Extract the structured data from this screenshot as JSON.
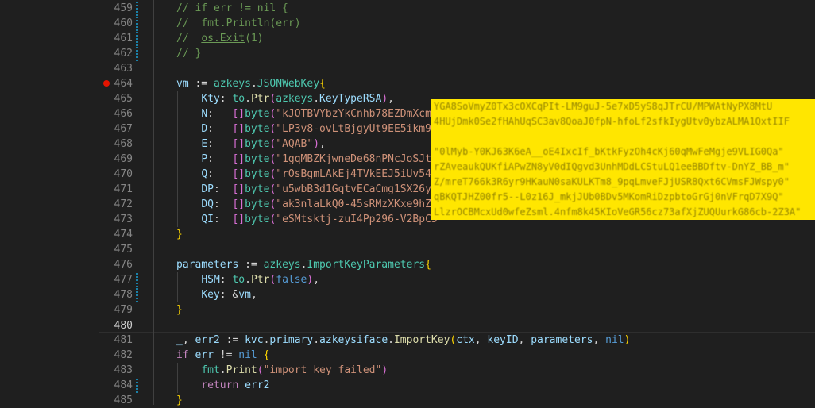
{
  "editor": {
    "lines": [
      {
        "num": "459",
        "tokens": [
          {
            "t": "// if err != nil {",
            "c": "c-comment"
          }
        ]
      },
      {
        "num": "460",
        "tokens": [
          {
            "t": "//  fmt.Println(err)",
            "c": "c-comment"
          }
        ]
      },
      {
        "num": "461",
        "tokens": [
          {
            "t": "//  ",
            "c": "c-comment"
          },
          {
            "t": "os.Exit",
            "c": "c-comment c-under"
          },
          {
            "t": "(1)",
            "c": "c-comment"
          }
        ]
      },
      {
        "num": "462",
        "tokens": [
          {
            "t": "// }",
            "c": "c-comment"
          }
        ]
      },
      {
        "num": "463",
        "tokens": []
      },
      {
        "num": "464",
        "breakpoint": true,
        "tokens": [
          {
            "t": "vm",
            "c": "c-var"
          },
          {
            "t": " := ",
            "c": "c-plain"
          },
          {
            "t": "azkeys",
            "c": "c-type"
          },
          {
            "t": ".",
            "c": "c-plain"
          },
          {
            "t": "JSONWebKey",
            "c": "c-type"
          },
          {
            "t": "{",
            "c": "c-b1"
          }
        ]
      },
      {
        "num": "465",
        "tokens": [
          {
            "t": "    ",
            "c": "c-plain"
          },
          {
            "t": "Kty",
            "c": "c-var"
          },
          {
            "t": ": ",
            "c": "c-plain"
          },
          {
            "t": "to",
            "c": "c-type"
          },
          {
            "t": ".",
            "c": "c-plain"
          },
          {
            "t": "Ptr",
            "c": "c-func"
          },
          {
            "t": "(",
            "c": "c-b2"
          },
          {
            "t": "azkeys",
            "c": "c-type"
          },
          {
            "t": ".",
            "c": "c-plain"
          },
          {
            "t": "KeyTypeRSA",
            "c": "c-var"
          },
          {
            "t": ")",
            "c": "c-b2"
          },
          {
            "t": ",",
            "c": "c-plain"
          }
        ]
      },
      {
        "num": "466",
        "tokens": [
          {
            "t": "    ",
            "c": "c-plain"
          },
          {
            "t": "N",
            "c": "c-var"
          },
          {
            "t": ":   ",
            "c": "c-plain"
          },
          {
            "t": "[]",
            "c": "c-b2"
          },
          {
            "t": "byte",
            "c": "c-type"
          },
          {
            "t": "(",
            "c": "c-b2"
          },
          {
            "t": "\"kJOTBVYbzYkCnhb78EZDmXcmH",
            "c": "c-str"
          }
        ]
      },
      {
        "num": "467",
        "tokens": [
          {
            "t": "    ",
            "c": "c-plain"
          },
          {
            "t": "D",
            "c": "c-var"
          },
          {
            "t": ":   ",
            "c": "c-plain"
          },
          {
            "t": "[]",
            "c": "c-b2"
          },
          {
            "t": "byte",
            "c": "c-type"
          },
          {
            "t": "(",
            "c": "c-b2"
          },
          {
            "t": "\"LP3v8-ovLtBjgyUt9EE5ikm9E",
            "c": "c-str"
          }
        ]
      },
      {
        "num": "468",
        "tokens": [
          {
            "t": "    ",
            "c": "c-plain"
          },
          {
            "t": "E",
            "c": "c-var"
          },
          {
            "t": ":   ",
            "c": "c-plain"
          },
          {
            "t": "[]",
            "c": "c-b2"
          },
          {
            "t": "byte",
            "c": "c-type"
          },
          {
            "t": "(",
            "c": "c-b2"
          },
          {
            "t": "\"AQAB\"",
            "c": "c-str"
          },
          {
            "t": ")",
            "c": "c-b2"
          },
          {
            "t": ",",
            "c": "c-plain"
          }
        ]
      },
      {
        "num": "469",
        "tokens": [
          {
            "t": "    ",
            "c": "c-plain"
          },
          {
            "t": "P",
            "c": "c-var"
          },
          {
            "t": ":   ",
            "c": "c-plain"
          },
          {
            "t": "[]",
            "c": "c-b2"
          },
          {
            "t": "byte",
            "c": "c-type"
          },
          {
            "t": "(",
            "c": "c-b2"
          },
          {
            "t": "\"1gqMBZKjwneDe68nPNcJoSJt4",
            "c": "c-str"
          }
        ]
      },
      {
        "num": "470",
        "tokens": [
          {
            "t": "    ",
            "c": "c-plain"
          },
          {
            "t": "Q",
            "c": "c-var"
          },
          {
            "t": ":   ",
            "c": "c-plain"
          },
          {
            "t": "[]",
            "c": "c-b2"
          },
          {
            "t": "byte",
            "c": "c-type"
          },
          {
            "t": "(",
            "c": "c-b2"
          },
          {
            "t": "\"rOsBgmLAkEj4TVkEEJ5iUv54f",
            "c": "c-str"
          }
        ]
      },
      {
        "num": "471",
        "tokens": [
          {
            "t": "    ",
            "c": "c-plain"
          },
          {
            "t": "DP",
            "c": "c-var"
          },
          {
            "t": ":  ",
            "c": "c-plain"
          },
          {
            "t": "[]",
            "c": "c-b2"
          },
          {
            "t": "byte",
            "c": "c-type"
          },
          {
            "t": "(",
            "c": "c-b2"
          },
          {
            "t": "\"u5wbB3d1GqtvECaCmg1SX26yK",
            "c": "c-str"
          }
        ]
      },
      {
        "num": "472",
        "tokens": [
          {
            "t": "    ",
            "c": "c-plain"
          },
          {
            "t": "DQ",
            "c": "c-var"
          },
          {
            "t": ":  ",
            "c": "c-plain"
          },
          {
            "t": "[]",
            "c": "c-b2"
          },
          {
            "t": "byte",
            "c": "c-type"
          },
          {
            "t": "(",
            "c": "c-b2"
          },
          {
            "t": "\"ak3nlaLkQ0-45sRMzXKxe9hZq",
            "c": "c-str"
          }
        ]
      },
      {
        "num": "473",
        "tokens": [
          {
            "t": "    ",
            "c": "c-plain"
          },
          {
            "t": "QI",
            "c": "c-var"
          },
          {
            "t": ":  ",
            "c": "c-plain"
          },
          {
            "t": "[]",
            "c": "c-b2"
          },
          {
            "t": "byte",
            "c": "c-type"
          },
          {
            "t": "(",
            "c": "c-b2"
          },
          {
            "t": "\"eSMtsktj-zuI4Pp296-V2BpC5",
            "c": "c-str"
          }
        ]
      },
      {
        "num": "474",
        "tokens": [
          {
            "t": "}",
            "c": "c-b1"
          }
        ]
      },
      {
        "num": "475",
        "tokens": []
      },
      {
        "num": "476",
        "tokens": [
          {
            "t": "parameters",
            "c": "c-var"
          },
          {
            "t": " := ",
            "c": "c-plain"
          },
          {
            "t": "azkeys",
            "c": "c-type"
          },
          {
            "t": ".",
            "c": "c-plain"
          },
          {
            "t": "ImportKeyParameters",
            "c": "c-type"
          },
          {
            "t": "{",
            "c": "c-b1"
          }
        ]
      },
      {
        "num": "477",
        "tokens": [
          {
            "t": "    ",
            "c": "c-plain"
          },
          {
            "t": "HSM",
            "c": "c-var"
          },
          {
            "t": ": ",
            "c": "c-plain"
          },
          {
            "t": "to",
            "c": "c-type"
          },
          {
            "t": ".",
            "c": "c-plain"
          },
          {
            "t": "Ptr",
            "c": "c-func"
          },
          {
            "t": "(",
            "c": "c-b2"
          },
          {
            "t": "false",
            "c": "c-kw"
          },
          {
            "t": ")",
            "c": "c-b2"
          },
          {
            "t": ",",
            "c": "c-plain"
          }
        ]
      },
      {
        "num": "478",
        "tokens": [
          {
            "t": "    ",
            "c": "c-plain"
          },
          {
            "t": "Key",
            "c": "c-var"
          },
          {
            "t": ": &",
            "c": "c-plain"
          },
          {
            "t": "vm",
            "c": "c-var"
          },
          {
            "t": ",",
            "c": "c-plain"
          }
        ]
      },
      {
        "num": "479",
        "tokens": [
          {
            "t": "}",
            "c": "c-b1"
          }
        ]
      },
      {
        "num": "480",
        "current": true,
        "tokens": []
      },
      {
        "num": "481",
        "tokens": [
          {
            "t": "_",
            "c": "c-var"
          },
          {
            "t": ", ",
            "c": "c-plain"
          },
          {
            "t": "err2",
            "c": "c-var"
          },
          {
            "t": " := ",
            "c": "c-plain"
          },
          {
            "t": "kvc",
            "c": "c-var"
          },
          {
            "t": ".",
            "c": "c-plain"
          },
          {
            "t": "primary",
            "c": "c-var"
          },
          {
            "t": ".",
            "c": "c-plain"
          },
          {
            "t": "azkeysiface",
            "c": "c-var"
          },
          {
            "t": ".",
            "c": "c-plain"
          },
          {
            "t": "ImportKey",
            "c": "c-func"
          },
          {
            "t": "(",
            "c": "c-b1"
          },
          {
            "t": "ctx",
            "c": "c-var"
          },
          {
            "t": ", ",
            "c": "c-plain"
          },
          {
            "t": "keyID",
            "c": "c-var"
          },
          {
            "t": ", ",
            "c": "c-plain"
          },
          {
            "t": "parameters",
            "c": "c-var"
          },
          {
            "t": ", ",
            "c": "c-plain"
          },
          {
            "t": "nil",
            "c": "c-kw"
          },
          {
            "t": ")",
            "c": "c-b1"
          }
        ]
      },
      {
        "num": "482",
        "tokens": [
          {
            "t": "if",
            "c": "c-ctl"
          },
          {
            "t": " ",
            "c": "c-plain"
          },
          {
            "t": "err",
            "c": "c-var"
          },
          {
            "t": " != ",
            "c": "c-plain"
          },
          {
            "t": "nil",
            "c": "c-kw"
          },
          {
            "t": " ",
            "c": "c-plain"
          },
          {
            "t": "{",
            "c": "c-b1"
          }
        ]
      },
      {
        "num": "483",
        "tokens": [
          {
            "t": "    ",
            "c": "c-plain"
          },
          {
            "t": "fmt",
            "c": "c-type"
          },
          {
            "t": ".",
            "c": "c-plain"
          },
          {
            "t": "Print",
            "c": "c-func"
          },
          {
            "t": "(",
            "c": "c-b2"
          },
          {
            "t": "\"import key failed\"",
            "c": "c-str"
          },
          {
            "t": ")",
            "c": "c-b2"
          }
        ]
      },
      {
        "num": "484",
        "tokens": [
          {
            "t": "    ",
            "c": "c-plain"
          },
          {
            "t": "return",
            "c": "c-ctl"
          },
          {
            "t": " ",
            "c": "c-plain"
          },
          {
            "t": "err2",
            "c": "c-var"
          }
        ]
      },
      {
        "num": "485",
        "tokens": [
          {
            "t": "}",
            "c": "c-b1"
          }
        ]
      }
    ],
    "redacted": [
      "YGA8SoVmyZ0Tx3cOXCqPIt-LM9guJ-5e7xD5yS8qJTrCU/MPWAtNyPX8MtU",
      "4HUjDmk0Se2fHAhUqSC3av8QoaJ0fpN-hfoLf2sfkIygUtv0ybzALMA1QxtIIF",
      "",
      "\"0lMyb-Y0KJ63K6eA__oE4IxcIf_bKtkFyzOh4cKj60qMwFeMgje9VLIG0Qa\"",
      "rZAveaukQUKfiAPwZN8yV0dIQgvd3UnhMDdLCStuLQ1eeBBDftv-DnYZ_BB_m\"",
      "Z/mreT766k3R6yr9HKauN0saKULKTm8_9pqLmveFJjUSR8Qxt6CVmsFJWspy0\"",
      "qBKQTJHZ00fr5--L0z16J_mkjJUb0BDv5MKomRiDzpbtoGrGj0nVFrqD7X9Q\"",
      "LlzrOCBMcxUd0wfeZsml.4nfm8k45KIoVeGR56cz73afXjZUQUurkG86cb-2Z3A\""
    ]
  }
}
